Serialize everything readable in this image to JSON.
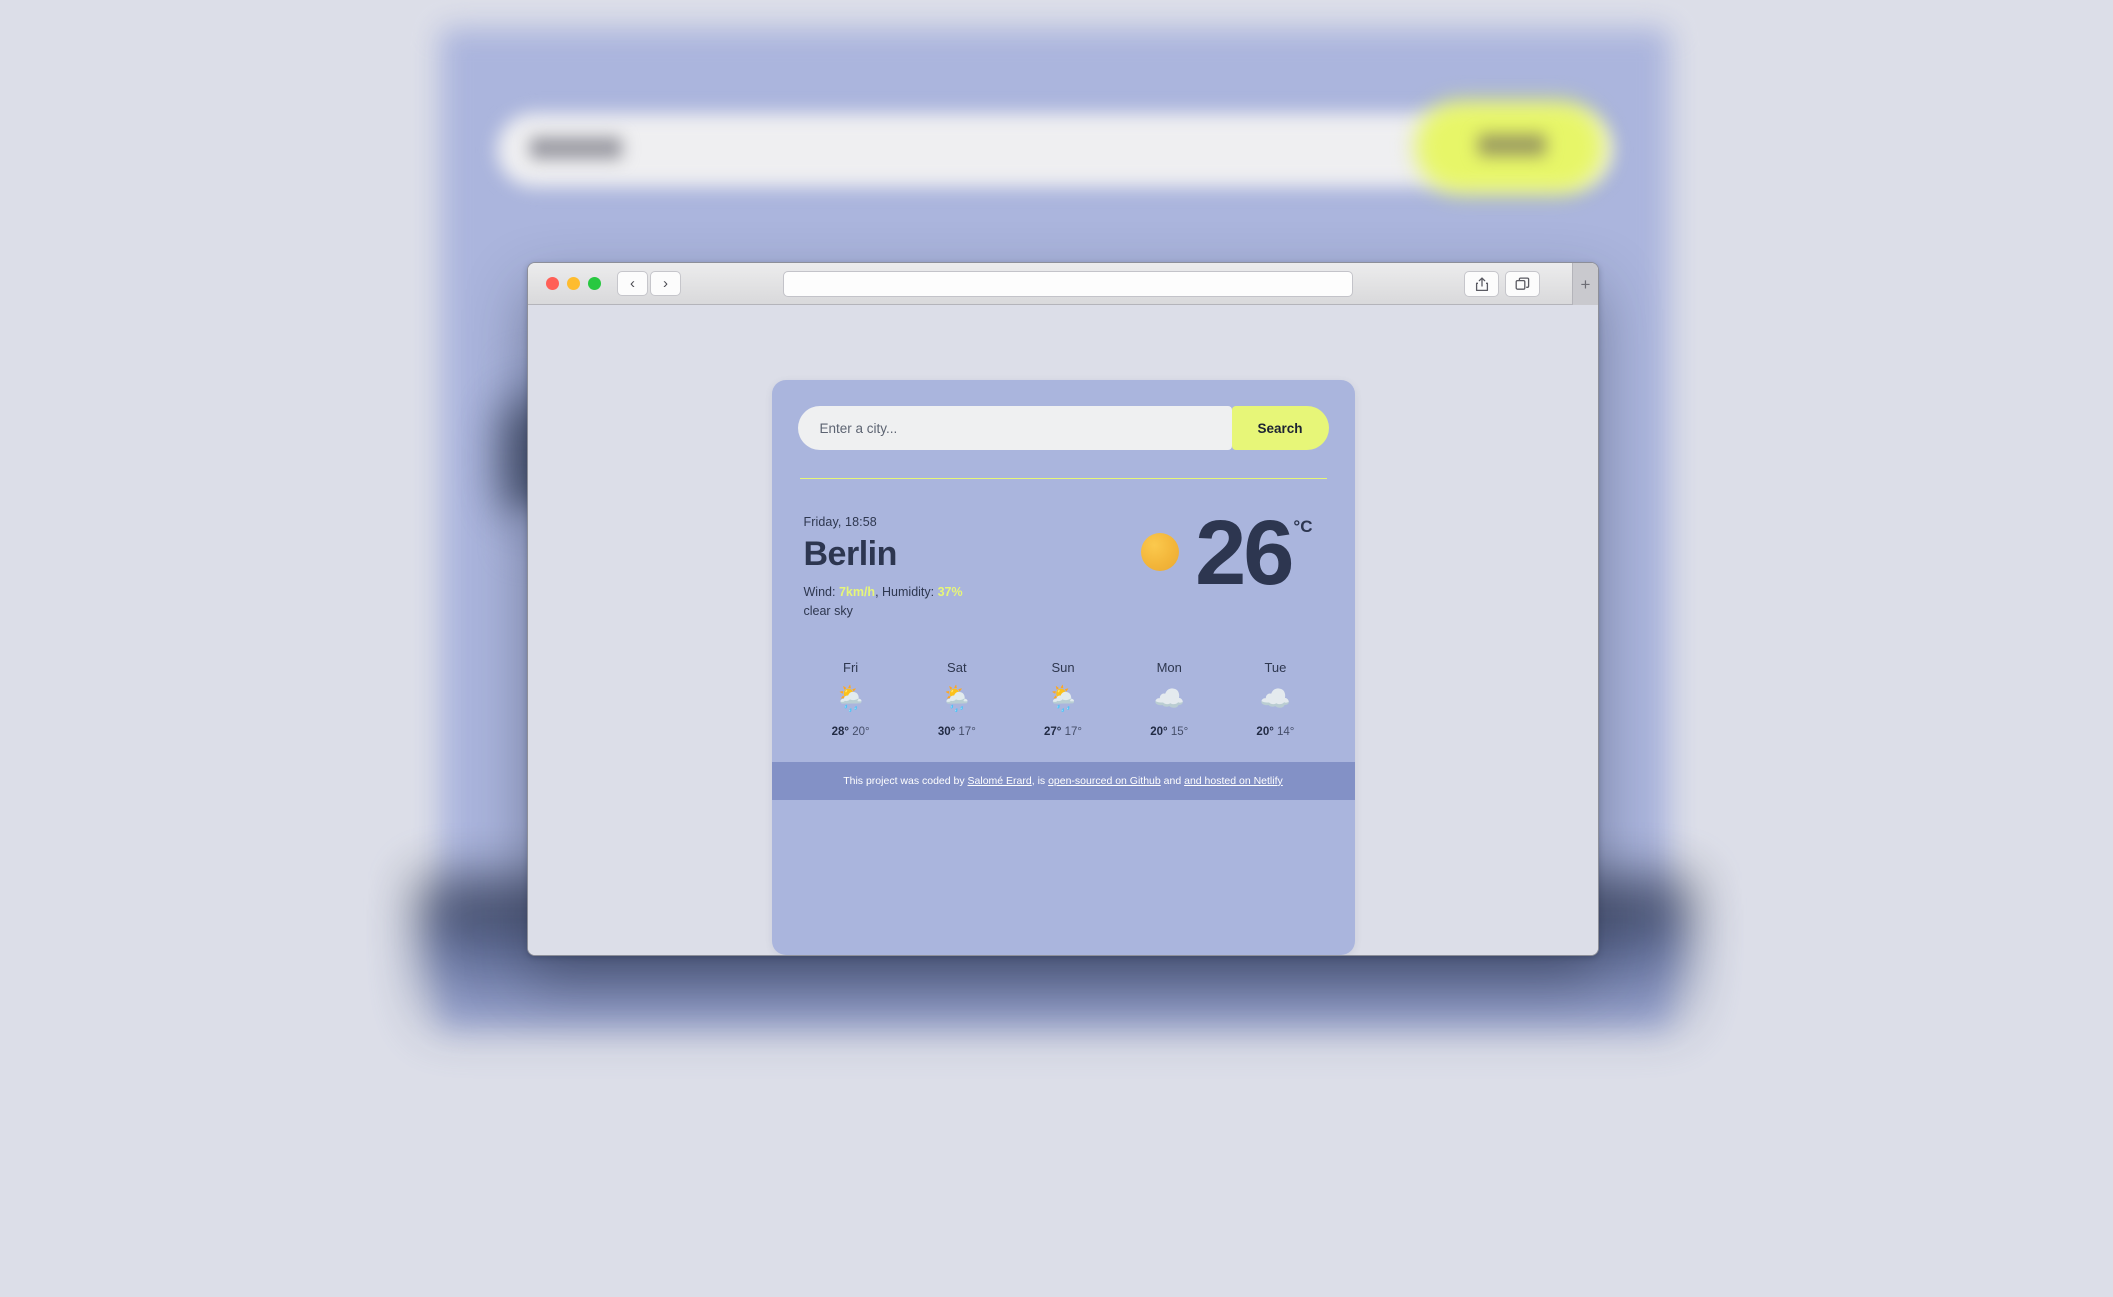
{
  "browser": {
    "traffic_lights": [
      "close",
      "minimize",
      "maximize"
    ],
    "back_label": "‹",
    "forward_label": "›",
    "address_value": "",
    "share_icon": "share-icon",
    "tabs_icon": "tabs-icon",
    "new_tab_label": "+"
  },
  "app": {
    "search": {
      "placeholder": "Enter a city...",
      "value": "",
      "button_label": "Search"
    },
    "current": {
      "datetime": "Friday, 18:58",
      "city": "Berlin",
      "wind_label": "Wind: ",
      "wind_value": "7km/h",
      "humidity_label": ", Humidity: ",
      "humidity_value": "37%",
      "condition": "clear sky",
      "icon": "sun-icon",
      "temperature": "26",
      "unit": "°C"
    },
    "forecast": [
      {
        "day": "Fri",
        "icon": "🌦️",
        "icon_name": "sun-behind-rain-cloud-icon",
        "high": "28°",
        "low": "20°"
      },
      {
        "day": "Sat",
        "icon": "🌦️",
        "icon_name": "sun-behind-rain-cloud-icon",
        "high": "30°",
        "low": "17°"
      },
      {
        "day": "Sun",
        "icon": "🌦️",
        "icon_name": "sun-behind-rain-cloud-icon",
        "high": "27°",
        "low": "17°"
      },
      {
        "day": "Mon",
        "icon": "☁️",
        "icon_name": "cloud-icon",
        "high": "20°",
        "low": "15°"
      },
      {
        "day": "Tue",
        "icon": "☁️",
        "icon_name": "cloud-icon",
        "high": "20°",
        "low": "14°"
      }
    ],
    "footer": {
      "prefix": "This project was coded by ",
      "author_link": "Salomé Erard",
      "middle": ", is ",
      "github_link": "open-sourced on Github",
      "conjunction": " and ",
      "netlify_link": "and hosted on Netlify"
    }
  },
  "colors": {
    "card_bg": "#aab5dd",
    "accent": "#e7f678",
    "text_dark": "#2d3650",
    "footer_bg": "#8391c6",
    "page_bg": "#dcdee8",
    "sun": "#f3b63a"
  }
}
